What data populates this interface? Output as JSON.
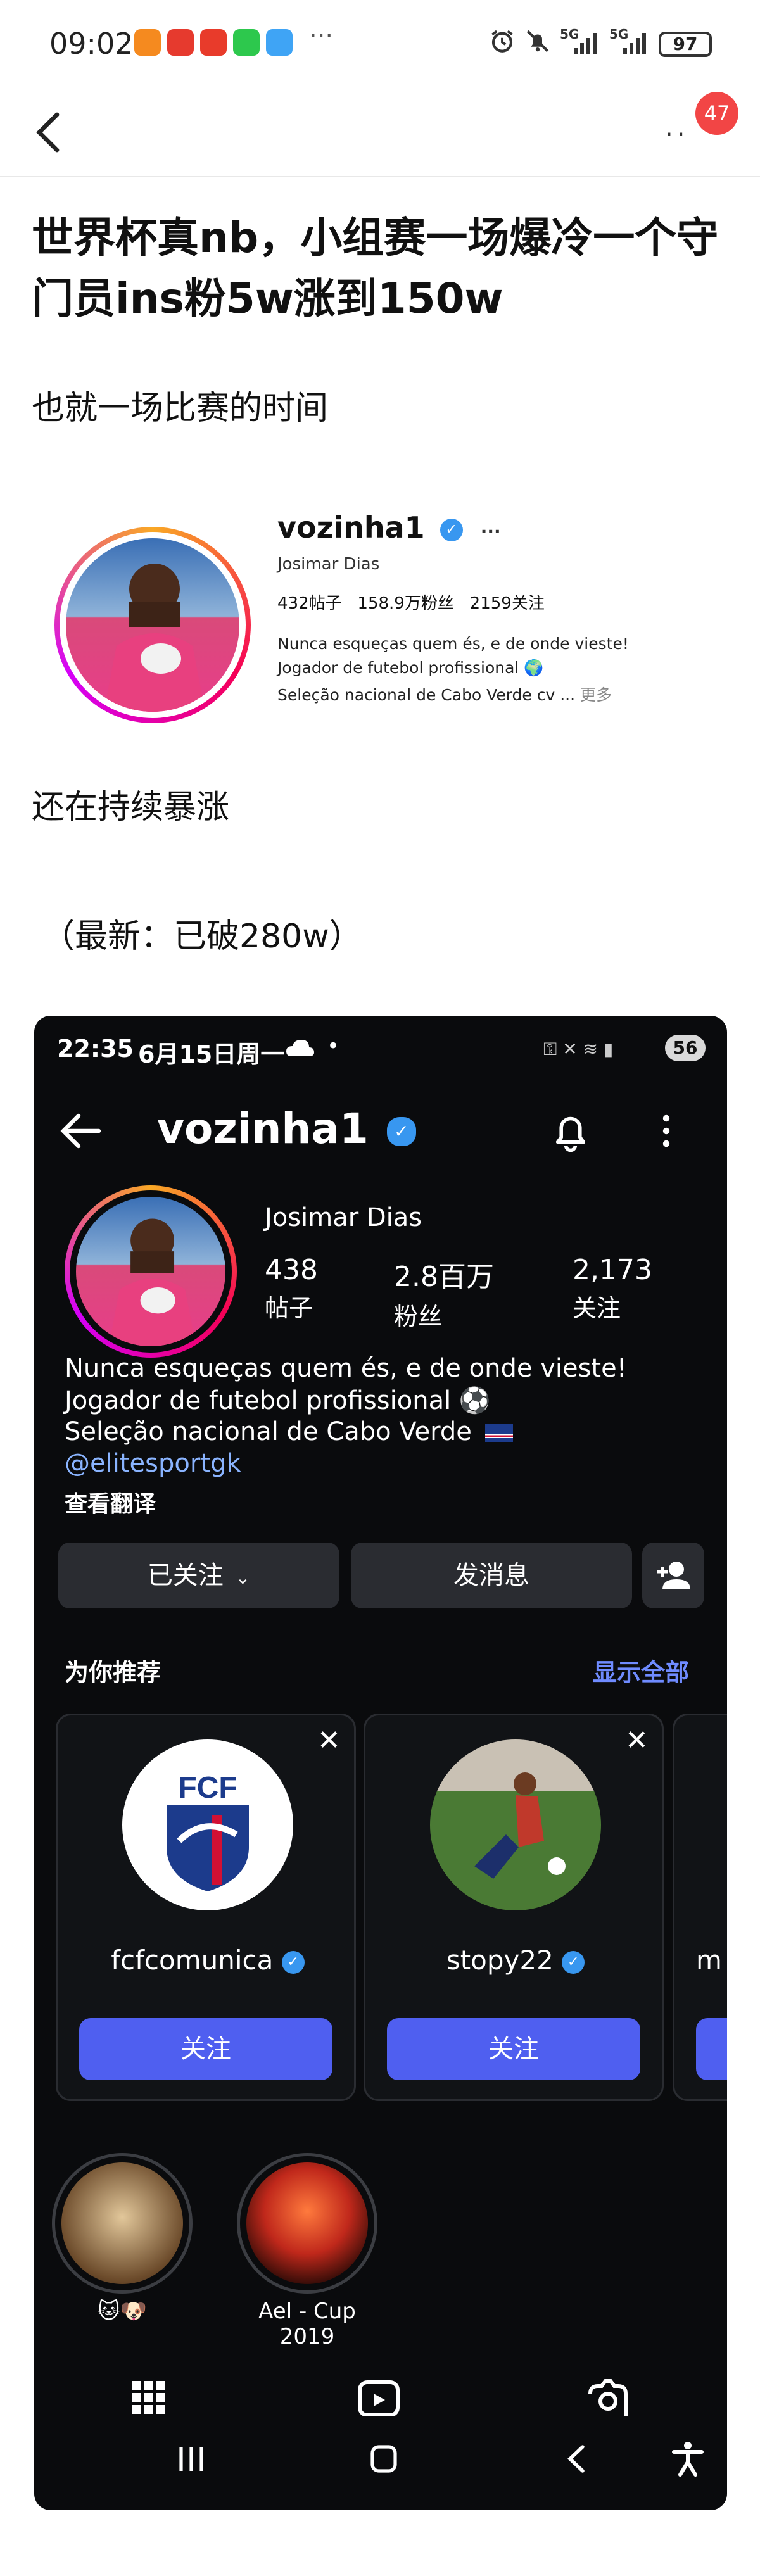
{
  "status_bar": {
    "time": "09:02",
    "more": "···",
    "net1": "5G",
    "net2": "5G",
    "battery": "97",
    "app_icon_colors": [
      "#f58a1f",
      "#e63a2e",
      "#e83b2b",
      "#2dc84d",
      "#3fa4f5"
    ],
    "icons": [
      "alarm-icon",
      "mute-icon",
      "signal-icon",
      "signal-icon",
      "battery-icon"
    ]
  },
  "nav": {
    "back_icon": "chevron-left-icon",
    "more_label": "··",
    "badge_count": "47"
  },
  "post": {
    "title": "世界杯真nb，小组赛一场爆冷一个守门员ins粉5w涨到150w",
    "line1": "也就一场比赛的时间",
    "line2": "还在持续暴涨",
    "line3": "（最新：已破280w）"
  },
  "small_profile": {
    "username": "vozinha1",
    "verified_icon": "verified-badge-icon",
    "more": "···",
    "full_name": "Josimar Dias",
    "stats": "432帖子   158.9万粉丝   2159关注",
    "bio1": "Nunca esqueças quem és, e de onde vieste!",
    "bio2": "Jogador de futebol profissional 🌍",
    "bio3": "Seleção nacional de Cabo Verde cv ...",
    "more_link": "更多"
  },
  "phone": {
    "status": {
      "time": "22:35",
      "date": "6月15日周一",
      "cloud_icon": "cloud-icon",
      "dot": "•",
      "battery": "56"
    },
    "header": {
      "back_icon": "arrow-left-icon",
      "username": "vozinha1",
      "bell_icon": "bell-icon",
      "kebab_icon": "vertical-dots-icon"
    },
    "profile": {
      "full_name": "Josimar Dias",
      "posts_count": "438",
      "posts_label": "帖子",
      "followers_count": "2.8百万",
      "followers_label": "粉丝",
      "following_count": "2,173",
      "following_label": "关注",
      "bio1": "Nunca esqueças quem és, e de onde vieste!",
      "bio2": "Jogador de futebol profissional ⚽",
      "bio3": "Seleção nacional de Cabo Verde",
      "bio_link": "@elitesportgk",
      "translate": "查看翻译"
    },
    "buttons": {
      "following": "已关注",
      "message": "发消息",
      "add_person_icon": "add-person-icon"
    },
    "suggestions": {
      "title": "为你推荐",
      "see_all": "显示全部",
      "items": [
        {
          "name": "fcfcomunica",
          "button": "关注",
          "logo_text": "FCF"
        },
        {
          "name": "stopy22",
          "button": "关注"
        },
        {
          "name": "m"
        }
      ]
    },
    "highlights": [
      {
        "label": "🐱🐶"
      },
      {
        "label": "Ael - Cup 2019"
      }
    ],
    "bottom_icons": [
      "grid-icon",
      "reels-icon",
      "tagged-icon"
    ],
    "system_nav": [
      "recents-icon",
      "home-icon",
      "back-icon",
      "accessibility-icon"
    ]
  }
}
